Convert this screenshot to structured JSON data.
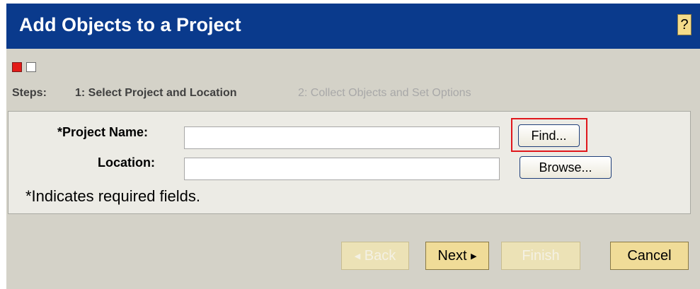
{
  "dialog": {
    "title": "Add Objects to a Project",
    "help_label": "?"
  },
  "steps": {
    "label": "Steps:",
    "items": [
      {
        "label": "1: Select Project and Location",
        "active": true
      },
      {
        "label": "2: Collect Objects and Set Options",
        "active": false
      }
    ]
  },
  "form": {
    "project_name": {
      "label": "*Project Name:",
      "value": "",
      "button": "Find..."
    },
    "location": {
      "label": "Location:",
      "value": "",
      "button": "Browse..."
    },
    "required_note": "*Indicates required fields."
  },
  "buttons": {
    "back": {
      "arrow": "◀",
      "label": "Back",
      "enabled": false
    },
    "next": {
      "label": "Next",
      "arrow": "▶",
      "enabled": true
    },
    "finish": {
      "label": "Finish",
      "enabled": false
    },
    "cancel": {
      "label": "Cancel",
      "enabled": true
    }
  },
  "colors": {
    "title_bar": "#0a3a8c",
    "dialog_background": "#d4d2c8",
    "active_step": "#e31b17",
    "button_fill": "#f0dc98",
    "highlight_box": "#e0171c"
  }
}
